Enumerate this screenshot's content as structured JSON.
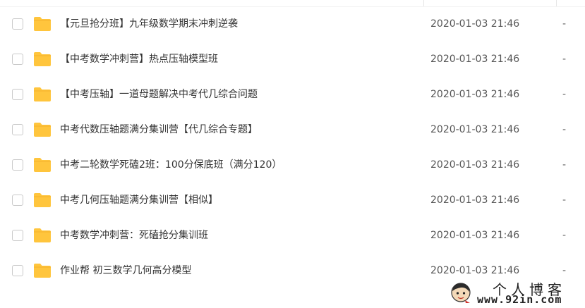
{
  "icons": {
    "folder": "folder-icon",
    "checkbox": "checkbox"
  },
  "colors": {
    "folder": "#ffc53d",
    "folder_tab": "#f5b12a",
    "text": "#333333"
  },
  "files": [
    {
      "name": "【元旦抢分班】九年级数学期末冲刺逆袭",
      "date": "2020-01-03 21:46",
      "size": "-"
    },
    {
      "name": "【中考数学冲刺营】热点压轴模型班",
      "date": "2020-01-03 21:46",
      "size": "-"
    },
    {
      "name": "【中考压轴】一道母题解决中考代几综合问题",
      "date": "2020-01-03 21:46",
      "size": "-"
    },
    {
      "name": "中考代数压轴题满分集训营【代几综合专题】",
      "date": "2020-01-03 21:46",
      "size": "-"
    },
    {
      "name": "中考二轮数学死磕2班：100分保底班（满分120）",
      "date": "2020-01-03 21:46",
      "size": "-"
    },
    {
      "name": "中考几何压轴题满分集训营【相似】",
      "date": "2020-01-03 21:46",
      "size": "-"
    },
    {
      "name": "中考数学冲刺营：死磕抢分集训班",
      "date": "2020-01-03 21:46",
      "size": "-"
    },
    {
      "name": "作业帮 初三数学几何高分模型",
      "date": "2020-01-03 21:46",
      "size": "-"
    }
  ],
  "watermark": {
    "title": "个人博客",
    "url": "www.92in.com"
  }
}
